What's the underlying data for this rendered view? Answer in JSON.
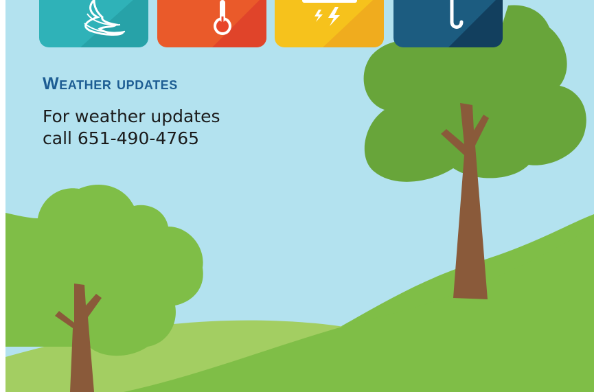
{
  "icons": {
    "tornado": {
      "name": "tornado-icon",
      "color": "#2fb2b8"
    },
    "heat": {
      "name": "thermometer-icon",
      "color": "#ea5a2a"
    },
    "storm": {
      "name": "lightning-icon",
      "color": "#f6b81c"
    },
    "rain": {
      "name": "umbrella-icon",
      "color": "#1c5c80"
    }
  },
  "section": {
    "heading": "Weather updates",
    "line1": "For weather updates",
    "line2": "call 651-490-4765"
  },
  "colors": {
    "sky": "#b3e2ef",
    "hill_dark": "#83c44d",
    "hill_light": "#a3ce62",
    "tree_foliage_back": "#6aa53a",
    "tree_foliage_front": "#7fbe47",
    "trunk": "#8a5a3a",
    "heading": "#1d5d93"
  }
}
